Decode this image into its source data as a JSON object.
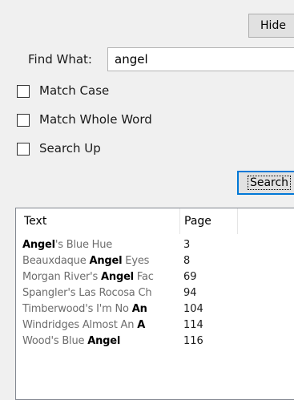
{
  "buttons": {
    "hide": "Hide",
    "search": "Search"
  },
  "find": {
    "label": "Find What:",
    "value": "angel"
  },
  "options": [
    {
      "label": "Match Case",
      "checked": false
    },
    {
      "label": "Match Whole Word",
      "checked": false
    },
    {
      "label": "Search Up",
      "checked": false
    }
  ],
  "results": {
    "columns": [
      "Text",
      "Page"
    ],
    "rows": [
      {
        "pre": "",
        "hit": "Angel",
        "post": "'s Blue Hue",
        "page": "3"
      },
      {
        "pre": "Beauxdaque ",
        "hit": "Angel",
        "post": " Eyes",
        "page": "8"
      },
      {
        "pre": "Morgan River's ",
        "hit": "Angel",
        "post": " Fac",
        "page": "69"
      },
      {
        "pre": "Spangler's Las Rocosa Ch",
        "hit": "",
        "post": "",
        "page": "94"
      },
      {
        "pre": "Timberwood's I'm No ",
        "hit": "An",
        "post": "",
        "page": "104"
      },
      {
        "pre": "Windridges Almost An ",
        "hit": "A",
        "post": "",
        "page": "114"
      },
      {
        "pre": "Wood's Blue ",
        "hit": "Angel",
        "post": "",
        "page": "116"
      }
    ]
  }
}
